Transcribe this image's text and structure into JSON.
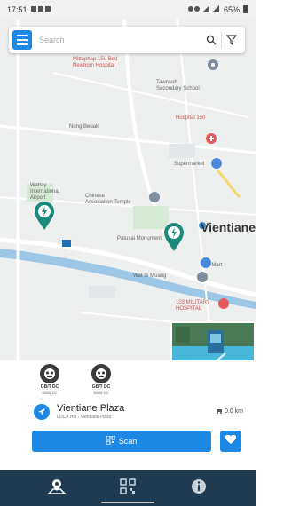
{
  "status_bar": {
    "time": "17:51",
    "battery": "65%"
  },
  "search": {
    "placeholder": "Search"
  },
  "map": {
    "labels": {
      "poi_hospital_top": "Mittaphap 150 Bed\nNewborn Hospital",
      "school": "Tawnsoh\nSecondary School",
      "village": "Nong Beuak",
      "hospital_150": "Hospital 150",
      "supermarket": "Supermarket",
      "wattay": "Wattay\nInternational\nAirport",
      "temple": "Chinese\nAssociation Temple",
      "patuxai": "Patuxai Monument",
      "city": "Vientiane",
      "d_mart": "D-Mart",
      "wat": "Wat Si Muang",
      "military_hospital": "103 MILITARY\nHOSPITAL"
    },
    "colors": {
      "charger_pin": "#1b8a7a",
      "road": "#ffffff",
      "river": "#9cc7e6",
      "park": "#d6ead5"
    }
  },
  "connectors": [
    {
      "label": "GB/T DC",
      "sub": "60kW DC"
    },
    {
      "label": "GB/T DC",
      "sub": "60kW DC"
    }
  ],
  "station": {
    "name": "Vientiane Plaza",
    "subtitle": "LOCA HQ - Vientiane Plaza",
    "distance": "0.0 km"
  },
  "actions": {
    "scan_label": "Scan"
  },
  "nav": {
    "items": [
      {
        "icon": "map-pin-icon"
      },
      {
        "icon": "qr-code-icon"
      },
      {
        "icon": "info-icon"
      }
    ]
  },
  "accent_color": "#1e88e5",
  "nav_bg": "#1f3b52"
}
